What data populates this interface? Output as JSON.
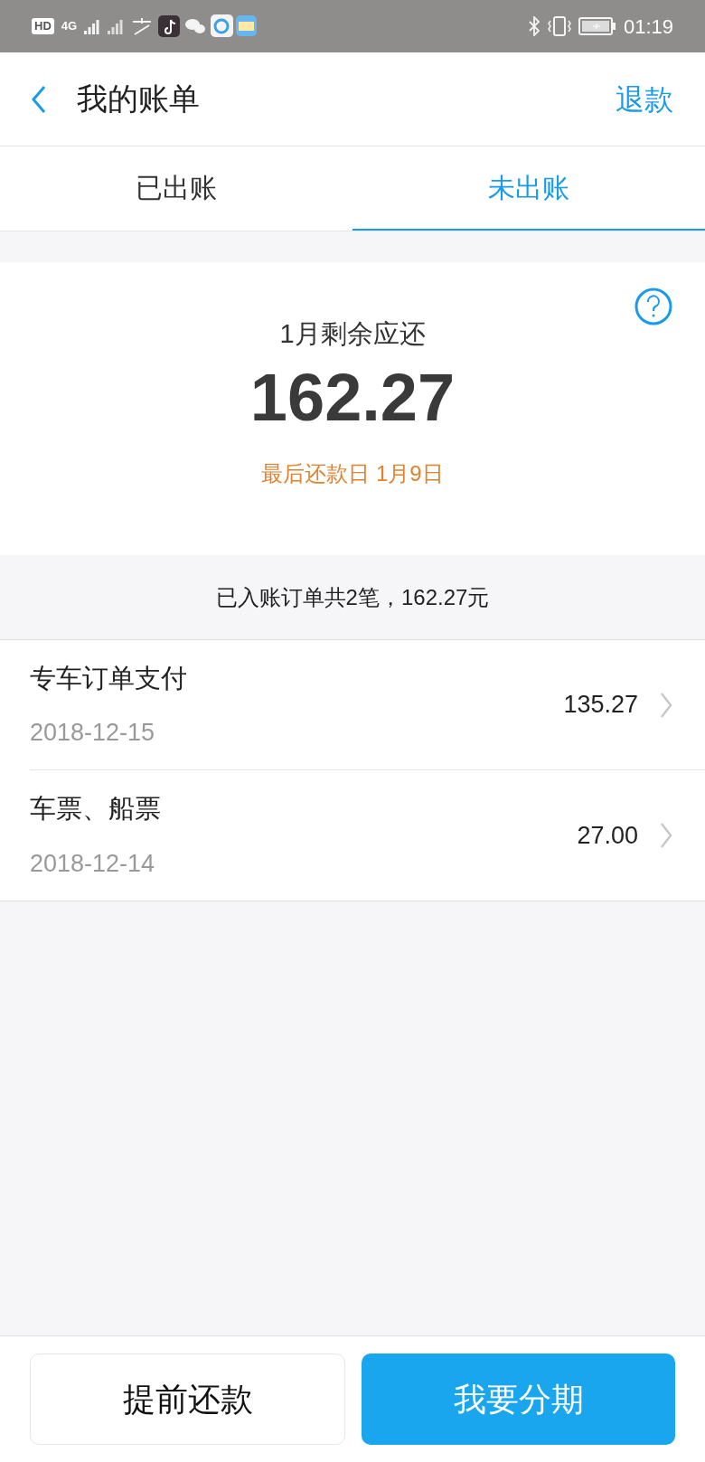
{
  "status_bar": {
    "hd": "HD",
    "network": "4G",
    "time": "01:19"
  },
  "header": {
    "title": "我的账单",
    "action": "退款"
  },
  "tabs": [
    {
      "label": "已出账",
      "selected": false
    },
    {
      "label": "未出账",
      "selected": true
    }
  ],
  "summary": {
    "label": "1月剩余应还",
    "amount": "162.27",
    "due": "最后还款日 1月9日"
  },
  "orders_summary": "已入账订单共2笔，162.27元",
  "orders": [
    {
      "name": "专车订单支付",
      "date": "2018-12-15",
      "amount": "135.27"
    },
    {
      "name": "车票、船票",
      "date": "2018-12-14",
      "amount": "27.00"
    }
  ],
  "buttons": [
    {
      "label": "提前还款",
      "kind": "secondary"
    },
    {
      "label": "我要分期",
      "kind": "primary"
    }
  ]
}
